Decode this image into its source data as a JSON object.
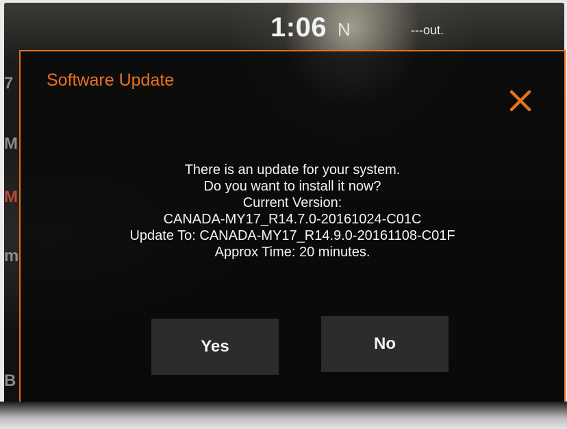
{
  "status_bar": {
    "time": "1:06",
    "compass": "N",
    "outside_temp": "---out."
  },
  "background_chars": [
    "7",
    "M",
    "M",
    "m",
    "B"
  ],
  "dialog": {
    "title": "Software Update",
    "close_icon": "close-icon",
    "message_lines": [
      "There is an update for your system.",
      "Do you want to install it now?",
      "Current Version:",
      "CANADA-MY17_R14.7.0-20161024-C01C",
      "Update To: CANADA-MY17_R14.9.0-20161108-C01F",
      "Approx Time: 20 minutes."
    ],
    "yes_label": "Yes",
    "no_label": "No"
  },
  "colors": {
    "accent": "#e6711f",
    "button_bg": "#2b2c2d",
    "text": "#f4f4f4"
  }
}
